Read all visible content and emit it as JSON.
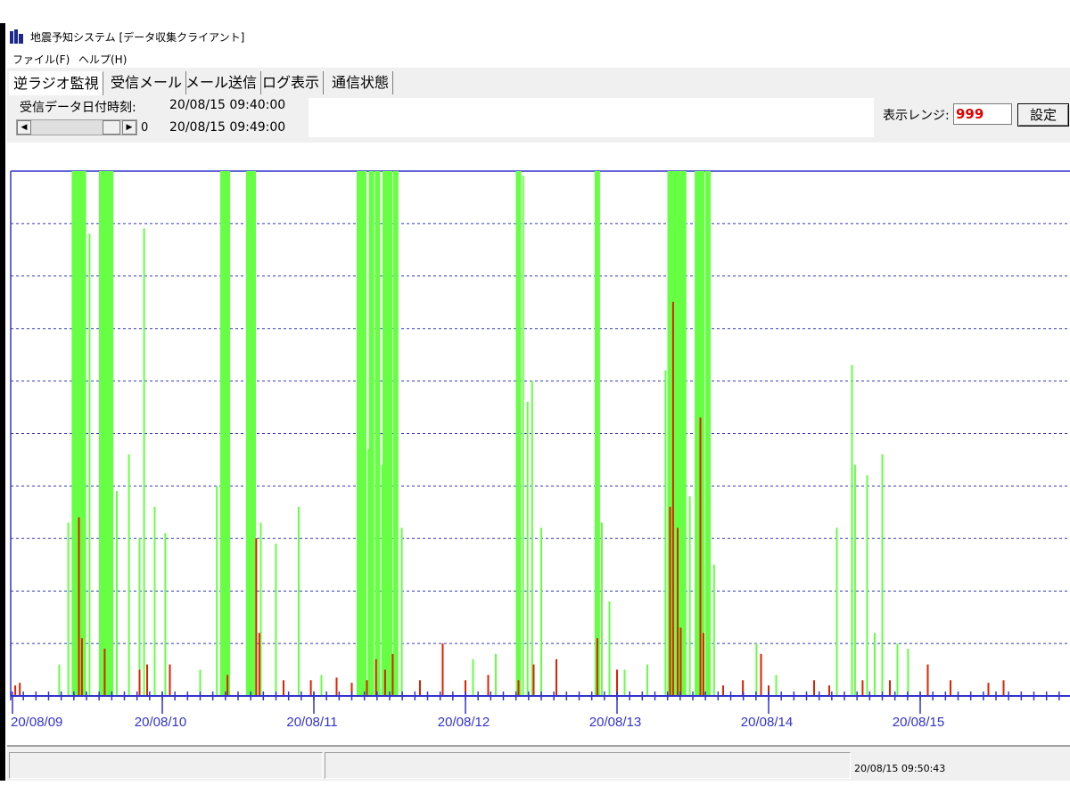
{
  "window": {
    "title": "地震予知システム [データ収集クライアント]"
  },
  "menu": [
    {
      "label": "ファイル(F)"
    },
    {
      "label": "ヘルプ(H)"
    }
  ],
  "tabs": [
    {
      "label": "逆ラジオ監視",
      "active": true
    },
    {
      "label": "受信メール"
    },
    {
      "label": "メール送信"
    },
    {
      "label": "ログ表示"
    },
    {
      "label": "通信状態"
    }
  ],
  "controls": {
    "received_label": "受信データ日付時刻:",
    "received_time": "20/08/15 09:40:00",
    "scroll_value": "0",
    "current_time": "20/08/15 09:49:00",
    "range_label": "表示レンジ:",
    "range_value": "999",
    "set_button": "設定"
  },
  "status": {
    "time": "20/08/15 09:50:43"
  },
  "colors": {
    "green_series": "#66ff44",
    "red_series": "#dd2200",
    "axis": "#3333cc",
    "grid": "#3333cc"
  },
  "chart_data": {
    "type": "bar",
    "grid": true,
    "ylim": [
      0,
      999
    ],
    "x_ticks": [
      "20/08/09",
      "20/08/10",
      "20/08/11",
      "20/08/12",
      "20/08/13",
      "20/08/14",
      "20/08/15"
    ],
    "series": [
      {
        "color": "#66ff44",
        "values": [
          {
            "x": 0.42,
            "y": 999
          },
          {
            "x": 0.45,
            "y": 999
          },
          {
            "x": 0.48,
            "y": 999
          },
          {
            "x": 0.38,
            "y": 330
          },
          {
            "x": 0.52,
            "y": 880
          },
          {
            "x": 0.6,
            "y": 999
          },
          {
            "x": 0.63,
            "y": 999
          },
          {
            "x": 0.66,
            "y": 999
          },
          {
            "x": 0.7,
            "y": 390
          },
          {
            "x": 0.78,
            "y": 460
          },
          {
            "x": 0.85,
            "y": 300
          },
          {
            "x": 0.88,
            "y": 890
          },
          {
            "x": 0.95,
            "y": 360
          },
          {
            "x": 1.02,
            "y": 310
          },
          {
            "x": 1.4,
            "y": 999
          },
          {
            "x": 1.43,
            "y": 999
          },
          {
            "x": 1.57,
            "y": 999
          },
          {
            "x": 1.6,
            "y": 999
          },
          {
            "x": 1.36,
            "y": 400
          },
          {
            "x": 1.65,
            "y": 330
          },
          {
            "x": 1.75,
            "y": 290
          },
          {
            "x": 1.9,
            "y": 360
          },
          {
            "x": 2.3,
            "y": 999
          },
          {
            "x": 2.33,
            "y": 999
          },
          {
            "x": 2.38,
            "y": 999
          },
          {
            "x": 2.42,
            "y": 999
          },
          {
            "x": 2.47,
            "y": 999
          },
          {
            "x": 2.5,
            "y": 999
          },
          {
            "x": 2.54,
            "y": 999
          },
          {
            "x": 2.36,
            "y": 470
          },
          {
            "x": 2.45,
            "y": 440
          },
          {
            "x": 2.53,
            "y": 460
          },
          {
            "x": 2.58,
            "y": 320
          },
          {
            "x": 3.35,
            "y": 999
          },
          {
            "x": 3.38,
            "y": 990
          },
          {
            "x": 3.41,
            "y": 560
          },
          {
            "x": 3.44,
            "y": 600
          },
          {
            "x": 3.5,
            "y": 320
          },
          {
            "x": 3.87,
            "y": 999
          },
          {
            "x": 3.9,
            "y": 330
          },
          {
            "x": 3.95,
            "y": 180
          },
          {
            "x": 4.32,
            "y": 620
          },
          {
            "x": 4.35,
            "y": 999
          },
          {
            "x": 4.38,
            "y": 999
          },
          {
            "x": 4.41,
            "y": 999
          },
          {
            "x": 4.44,
            "y": 999
          },
          {
            "x": 4.53,
            "y": 999
          },
          {
            "x": 4.56,
            "y": 999
          },
          {
            "x": 4.6,
            "y": 999
          },
          {
            "x": 4.48,
            "y": 380
          },
          {
            "x": 4.64,
            "y": 250
          },
          {
            "x": 4.92,
            "y": 100
          },
          {
            "x": 5.45,
            "y": 320
          },
          {
            "x": 5.55,
            "y": 630
          },
          {
            "x": 5.57,
            "y": 440
          },
          {
            "x": 5.65,
            "y": 420
          },
          {
            "x": 5.7,
            "y": 120
          },
          {
            "x": 5.75,
            "y": 460
          },
          {
            "x": 5.85,
            "y": 100
          },
          {
            "x": 5.92,
            "y": 90
          },
          {
            "x": 0.32,
            "y": 60
          },
          {
            "x": 1.25,
            "y": 50
          },
          {
            "x": 2.05,
            "y": 40
          },
          {
            "x": 3.05,
            "y": 70
          },
          {
            "x": 3.2,
            "y": 80
          },
          {
            "x": 4.05,
            "y": 50
          },
          {
            "x": 4.2,
            "y": 60
          },
          {
            "x": 5.05,
            "y": 40
          }
        ]
      },
      {
        "color": "#dd2200",
        "values": [
          {
            "x": 0.03,
            "y": 20
          },
          {
            "x": 0.06,
            "y": 25
          },
          {
            "x": 0.45,
            "y": 340
          },
          {
            "x": 0.47,
            "y": 110
          },
          {
            "x": 0.62,
            "y": 90
          },
          {
            "x": 0.85,
            "y": 50
          },
          {
            "x": 0.9,
            "y": 60
          },
          {
            "x": 1.05,
            "y": 60
          },
          {
            "x": 1.43,
            "y": 40
          },
          {
            "x": 1.62,
            "y": 300
          },
          {
            "x": 1.64,
            "y": 120
          },
          {
            "x": 1.8,
            "y": 30
          },
          {
            "x": 1.98,
            "y": 30
          },
          {
            "x": 2.15,
            "y": 35
          },
          {
            "x": 2.25,
            "y": 25
          },
          {
            "x": 2.35,
            "y": 30
          },
          {
            "x": 2.41,
            "y": 70
          },
          {
            "x": 2.47,
            "y": 50
          },
          {
            "x": 2.52,
            "y": 80
          },
          {
            "x": 2.7,
            "y": 30
          },
          {
            "x": 2.85,
            "y": 100
          },
          {
            "x": 3.0,
            "y": 30
          },
          {
            "x": 3.15,
            "y": 40
          },
          {
            "x": 3.35,
            "y": 30
          },
          {
            "x": 3.45,
            "y": 60
          },
          {
            "x": 3.6,
            "y": 70
          },
          {
            "x": 3.87,
            "y": 110
          },
          {
            "x": 4.0,
            "y": 50
          },
          {
            "x": 4.35,
            "y": 360
          },
          {
            "x": 4.37,
            "y": 750
          },
          {
            "x": 4.4,
            "y": 320
          },
          {
            "x": 4.42,
            "y": 130
          },
          {
            "x": 4.55,
            "y": 530
          },
          {
            "x": 4.57,
            "y": 120
          },
          {
            "x": 4.7,
            "y": 20
          },
          {
            "x": 4.83,
            "y": 30
          },
          {
            "x": 4.95,
            "y": 80
          },
          {
            "x": 5.0,
            "y": 20
          },
          {
            "x": 5.3,
            "y": 30
          },
          {
            "x": 5.4,
            "y": 20
          },
          {
            "x": 5.62,
            "y": 30
          },
          {
            "x": 5.8,
            "y": 30
          },
          {
            "x": 6.05,
            "y": 60
          },
          {
            "x": 6.2,
            "y": 30
          },
          {
            "x": 6.45,
            "y": 25
          },
          {
            "x": 6.55,
            "y": 30
          }
        ]
      }
    ]
  }
}
